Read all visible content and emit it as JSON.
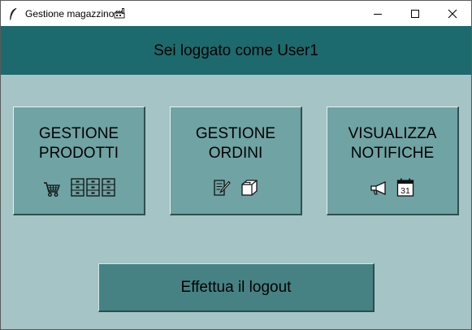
{
  "window": {
    "title": "Gestione magazzino",
    "title_emoji_icon": "factory-icon",
    "app_icon": "feather-icon",
    "controls": [
      "minimize-icon",
      "maximize-icon",
      "close-icon"
    ]
  },
  "header": {
    "text": "Sei loggato come User1",
    "background": "#1c6a6e"
  },
  "tiles": [
    {
      "line1": "GESTIONE",
      "line2": "PRODOTTI",
      "icons": [
        "shopping-cart-icon",
        "file-cabinet-icon",
        "file-cabinet-icon",
        "file-cabinet-icon"
      ]
    },
    {
      "line1": "GESTIONE",
      "line2": "ORDINI",
      "icons": [
        "memo-icon",
        "package-icon"
      ]
    },
    {
      "line1": "VISUALIZZA",
      "line2": "NOTIFICHE",
      "icons": [
        "megaphone-icon",
        "calendar-icon"
      ]
    }
  ],
  "calendar_day": "31",
  "logout": {
    "label": "Effettua il logout"
  },
  "colors": {
    "background": "#a4c4c6",
    "tile": "#6fa3a4",
    "logout_button": "#468283"
  }
}
